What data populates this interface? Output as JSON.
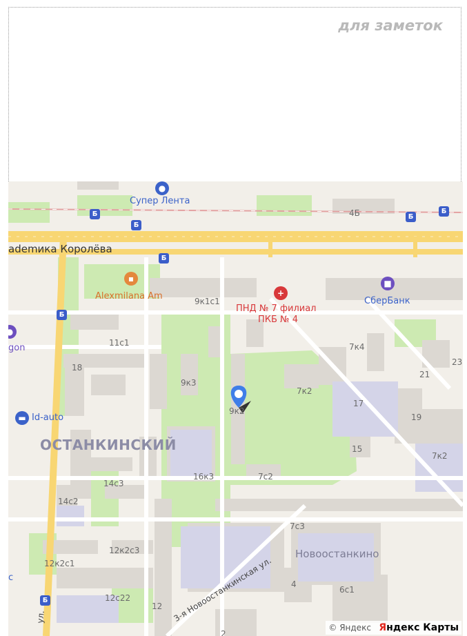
{
  "notes": {
    "title": "для заметок"
  },
  "map": {
    "street_main": "ademика Королёва",
    "street_diag": "3-я Новоостанкинская ул.",
    "street_left_tail": "ул.",
    "district": "ОСТАНКИНСКИЙ",
    "neighborhood": "Новоостанкино",
    "pois": {
      "superlenta": "Супер Лента",
      "alexmilana": "Alexmilana Am",
      "pnd": "ПНД № 7 филиал",
      "pkb": "ПКБ № 4",
      "sberbank": "СберБанк",
      "idauto": "Id-auto",
      "gon": "gon",
      "partial_c": "с"
    },
    "houses": [
      "4Б",
      "9к1с1",
      "11с1",
      "18",
      "9к3",
      "9к2",
      "7к4",
      "7к2",
      "17",
      "21",
      "19",
      "23",
      "15",
      "7к2",
      "16к3",
      "7с2",
      "14с3",
      "14с2",
      "7с3",
      "12к2с3",
      "12к2с1",
      "12с22",
      "12",
      "4",
      "6с1",
      "2"
    ],
    "icons": {
      "superlenta": "shopping-bag-icon",
      "alexmilana": "coffee-cup-icon",
      "pnd": "medical-cross-icon",
      "sberbank": "bank-icon",
      "idauto": "car-icon",
      "gon": "shop-icon",
      "metro": "bus-stop-icon",
      "marker": "location-pin-icon"
    },
    "marker_letter": "",
    "colors": {
      "road": "#f8d673",
      "green": "#cdeab2",
      "building": "#dcd8d2",
      "marker": "#3f7ee8"
    }
  },
  "attribution": {
    "copyright": "© Яндекс",
    "brand_ya": "Я",
    "brand_rest": "ндекс Карты"
  }
}
